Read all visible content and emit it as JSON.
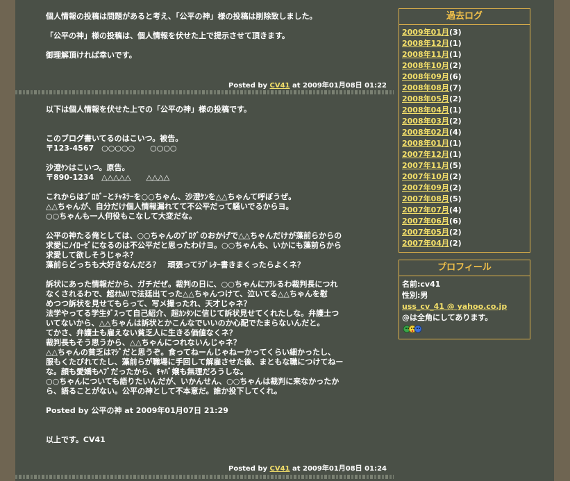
{
  "entries": [
    {
      "paragraphs": [
        "個人情報の投稿は問題があると考え、「公平の神」様の投稿は削除致しました。",
        "「公平の神」様の投稿は、個人情報を伏せた上で提示させて頂きます。",
        "御理解頂ければ幸いです。"
      ],
      "posted_prefix": "Posted by",
      "author": "CV41",
      "posted_suffix": "at 2009年01月08日 01:22"
    },
    {
      "paragraphs": [
        "以下は個人情報を伏せた上での「公平の神」様の投稿です。",
        "このブログ書いてるのはこいつ。被告。\n〒123-4567　○○○○○　　○○○○",
        "沙澄ｹﾝはこいつ。原告。\n〒890-1234　△△△△△　　△△△△",
        "これからはﾌﾞﾛｶﾞｰとﾁｬﾈﾗｰを○○ちゃん、沙澄ｹﾝを△△ちゃんて呼ぼうぜ。\n△△ちゃんが、自分だけ個人情報漏れてて不公平だって騒いでるからヨ。\n○○ちゃんも一人何役もこなして大変だな。",
        "公平の神たる俺としては、○○ちゃんのﾌﾞﾛｸﾞのおかげで△△ちゃんだけが藻前らからの\n求愛にﾉｲﾛｰｾﾞになるのは不公平だと思ったわけヨ。○○ちゃんも、いかにも藻前らから\n求愛して欲しそうじゃネ？\n藻前らどっちも大好きなんだろ？　頑張ってﾗﾌﾞﾚﾀｰ書きまくったらよくネ？",
        "訴状にあった情報だから、ガチだぜ。裁判の日に、○○ちゃんにﾌﾗﾚるわ裁判長につれ\nなくされるわで、超ｵｶﾑﾘで法廷出てった△△ちゃんつけて、泣いてる△△ちゃんを慰\nめつつ訴状を見せてもらって、写メ撮ったれ、天才じゃネ？\n法学やってる学生ﾀﾞｽって自己紹介、超ｶﾝﾀﾝに信じて訴状見せてくれたしな。弁護士つ\nいてないから、△△ちゃんは訴状とかこんなでいいのか心配でたまらないんだと。\nてかさ、弁護士も雇えない貧乏人に生きる価値なくネ？\n裁判長もそう思うから、△△ちゃんにつれないんじゃネ？\n△△ちゃんの貧乏はﾏｼﾞだと思うぞ。食ってねーんじゃねーかってくらい細かったし、\n服もくたびれてたし、藻前らが職場に手回して解雇させた後、まともな職につけてねー\nな。顔も愛嬌もﾍﾌﾞだったから、ｷｬﾊﾞ嬢も無理だろうしな。\n○○ちゃんについても語りたいんだが、いかんせん、○○ちゃんは裁判に来なかったか\nら、語ることがない。公平の神として不本意だ。誰か投下してくれ。",
        "Posted by 公平の神 at 2009年01月07日 21:29",
        "以上です。CV41"
      ],
      "posted_prefix": "Posted by",
      "author": "CV41",
      "posted_suffix": "at 2009年01月08日 01:24"
    }
  ],
  "archive": {
    "title": "過去ログ",
    "items": [
      {
        "month": "2009年01月",
        "count": "(3)"
      },
      {
        "month": "2008年12月",
        "count": "(1)"
      },
      {
        "month": "2008年11月",
        "count": "(1)"
      },
      {
        "month": "2008年10月",
        "count": "(2)"
      },
      {
        "month": "2008年09月",
        "count": "(6)"
      },
      {
        "month": "2008年08月",
        "count": "(7)"
      },
      {
        "month": "2008年05月",
        "count": "(2)"
      },
      {
        "month": "2008年04月",
        "count": "(1)"
      },
      {
        "month": "2008年03月",
        "count": "(2)"
      },
      {
        "month": "2008年02月",
        "count": "(4)"
      },
      {
        "month": "2008年01月",
        "count": "(1)"
      },
      {
        "month": "2007年12月",
        "count": "(1)"
      },
      {
        "month": "2007年11月",
        "count": "(5)"
      },
      {
        "month": "2007年10月",
        "count": "(2)"
      },
      {
        "month": "2007年09月",
        "count": "(2)"
      },
      {
        "month": "2007年08月",
        "count": "(5)"
      },
      {
        "month": "2007年07月",
        "count": "(4)"
      },
      {
        "month": "2007年06月",
        "count": "(6)"
      },
      {
        "month": "2007年05月",
        "count": "(2)"
      },
      {
        "month": "2007年04月",
        "count": "(2)"
      }
    ]
  },
  "profile": {
    "title": "プロフィール",
    "name": "名前:cv41",
    "gender": "性別:男",
    "email": "uss_cv_41 @ yahoo.co.jp",
    "note": "@は全角にしてあります。",
    "icon": "face-emoji-icon"
  },
  "colors": {
    "background": "#6f6552",
    "panel": "#4a5047",
    "link": "#f3df6a",
    "accent": "#f1c04a",
    "border": "#e0b24a"
  }
}
